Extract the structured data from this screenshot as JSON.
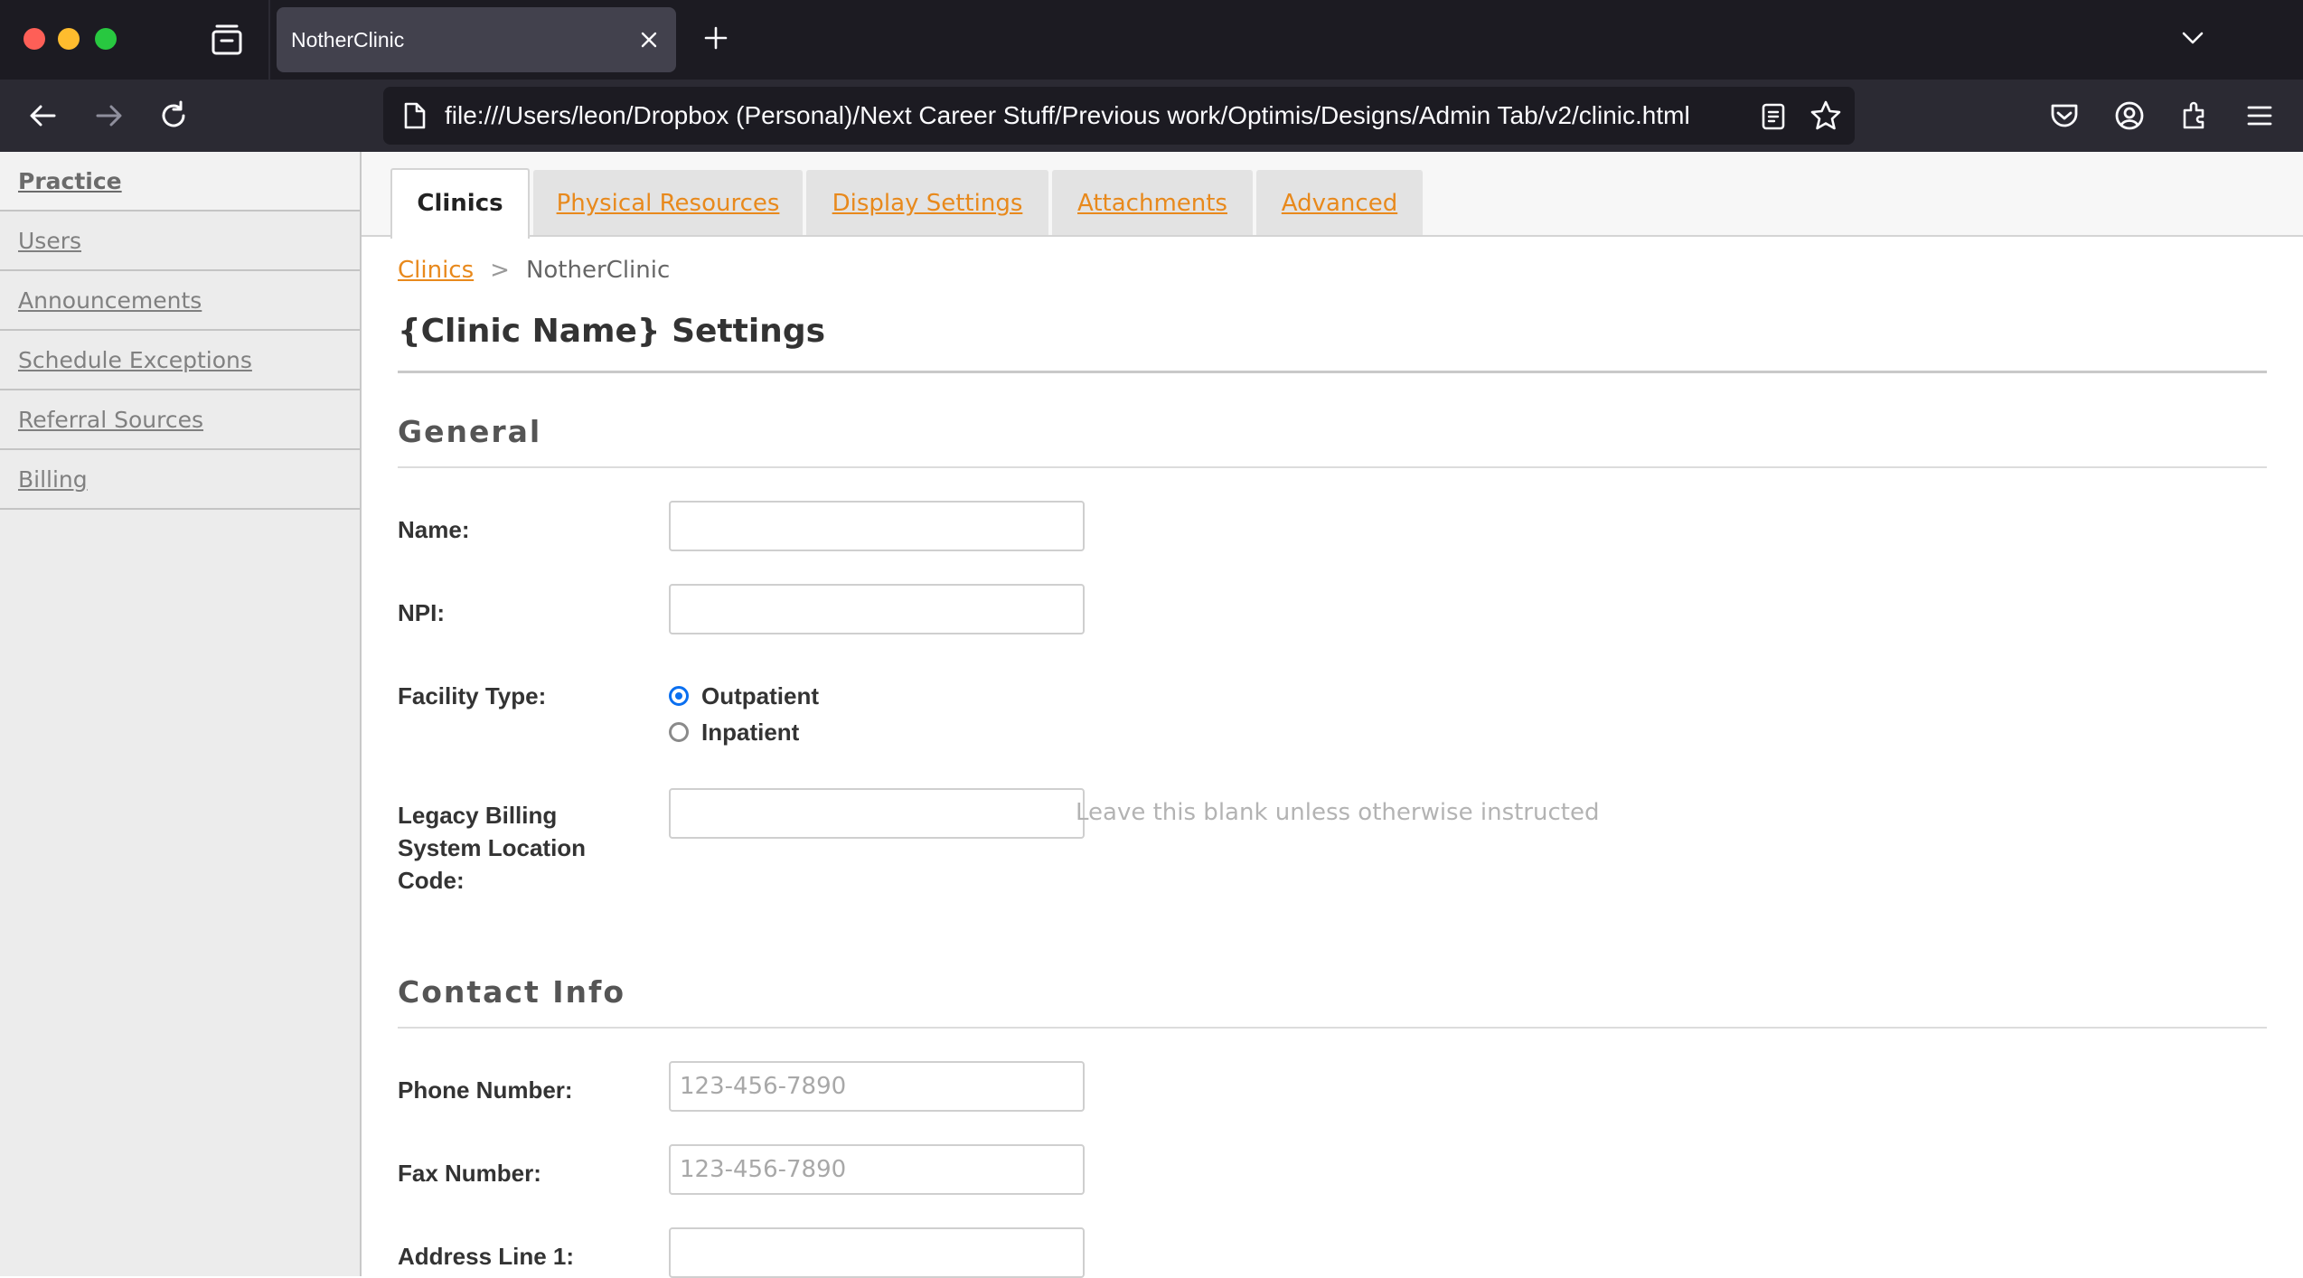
{
  "browser": {
    "tab_title": "NotherClinic",
    "url": "file:///Users/leon/Dropbox (Personal)/Next Career Stuff/Previous work/Optimis/Designs/Admin Tab/v2/clinic.html"
  },
  "sidebar": {
    "items": [
      {
        "label": "Practice",
        "active": true
      },
      {
        "label": "Users"
      },
      {
        "label": "Announcements"
      },
      {
        "label": "Schedule Exceptions"
      },
      {
        "label": "Referral Sources"
      },
      {
        "label": "Billing"
      }
    ]
  },
  "tabs": [
    {
      "label": "Clinics",
      "active": true
    },
    {
      "label": "Physical Resources"
    },
    {
      "label": "Display Settings"
    },
    {
      "label": "Attachments"
    },
    {
      "label": "Advanced"
    }
  ],
  "breadcrumb": {
    "link": "Clinics",
    "separator": ">",
    "current": "NotherClinic"
  },
  "page_title": "{Clinic Name} Settings",
  "general": {
    "title": "General",
    "name_label": "Name:",
    "name_value": "",
    "npi_label": "NPI:",
    "npi_value": "",
    "facility_label": "Facility Type:",
    "facility_options": [
      {
        "label": "Outpatient",
        "checked": true
      },
      {
        "label": "Inpatient",
        "checked": false
      }
    ],
    "legacy_label": "Legacy Billing System Location Code:",
    "legacy_value": "",
    "legacy_hint": "Leave this blank unless otherwise instructed"
  },
  "contact": {
    "title": "Contact Info",
    "phone_label": "Phone Number:",
    "phone_placeholder": "123-456-7890",
    "fax_label": "Fax Number:",
    "fax_placeholder": "123-456-7890",
    "address1_label": "Address Line 1:",
    "address1_value": ""
  },
  "colors": {
    "accent_link": "#e8891c",
    "radio_checked": "#0a6ff0",
    "chrome_dark": "#1c1b22"
  }
}
